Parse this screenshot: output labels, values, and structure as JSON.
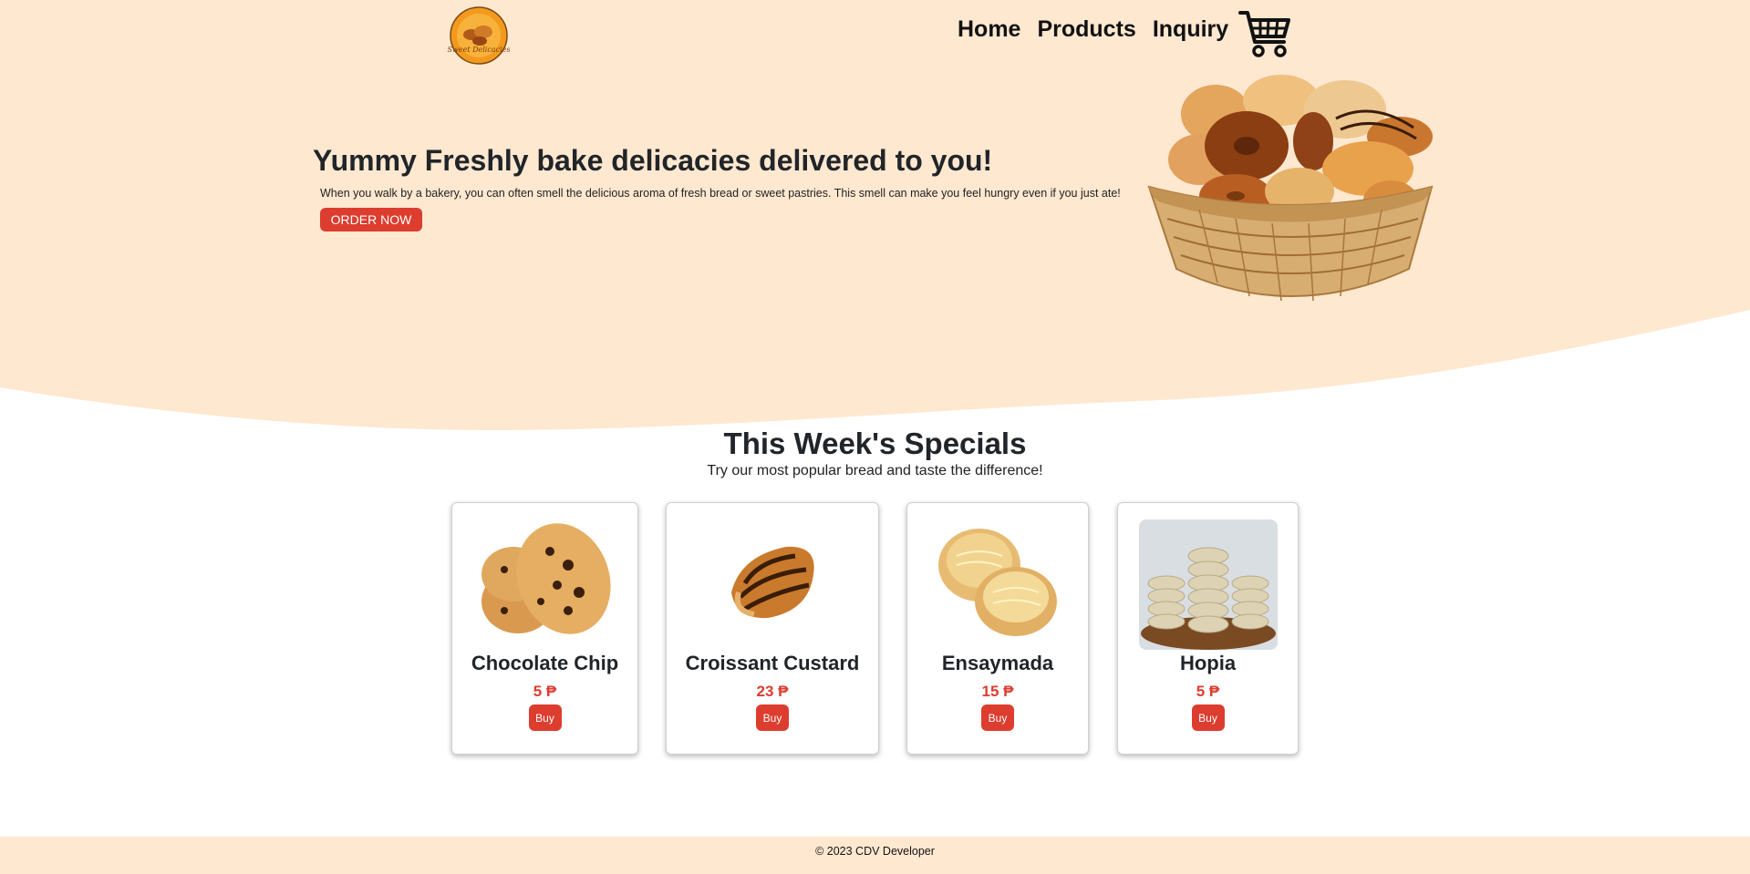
{
  "colors": {
    "hero_bg": "#ffe8d0",
    "accent": "#dc3d2f",
    "text": "#212529"
  },
  "logo": {
    "text": "Sweet Delicacies"
  },
  "nav": {
    "items": [
      {
        "label": "Home"
      },
      {
        "label": "Products"
      },
      {
        "label": "Inquiry"
      }
    ],
    "cart_icon": "cart-icon"
  },
  "hero": {
    "title": "Yummy Freshly bake delicacies delivered to you!",
    "text": "When you walk by a bakery, you can often smell the delicious aroma of fresh bread or sweet pastries. This smell can make you feel hungry even if you just ate!",
    "button": "ORDER NOW"
  },
  "specials": {
    "title": "This Week's Specials",
    "subtitle": "Try our most popular bread and taste the difference!",
    "products": [
      {
        "name": "Chocolate Chip",
        "price": "5 ₱",
        "button": "Buy"
      },
      {
        "name": "Croissant Custard",
        "price": "23 ₱",
        "button": "Buy"
      },
      {
        "name": "Ensaymada",
        "price": "15 ₱",
        "button": "Buy"
      },
      {
        "name": "Hopia",
        "price": "5 ₱",
        "button": "Buy"
      }
    ]
  },
  "footer": {
    "text": "© 2023 CDV Developer"
  }
}
